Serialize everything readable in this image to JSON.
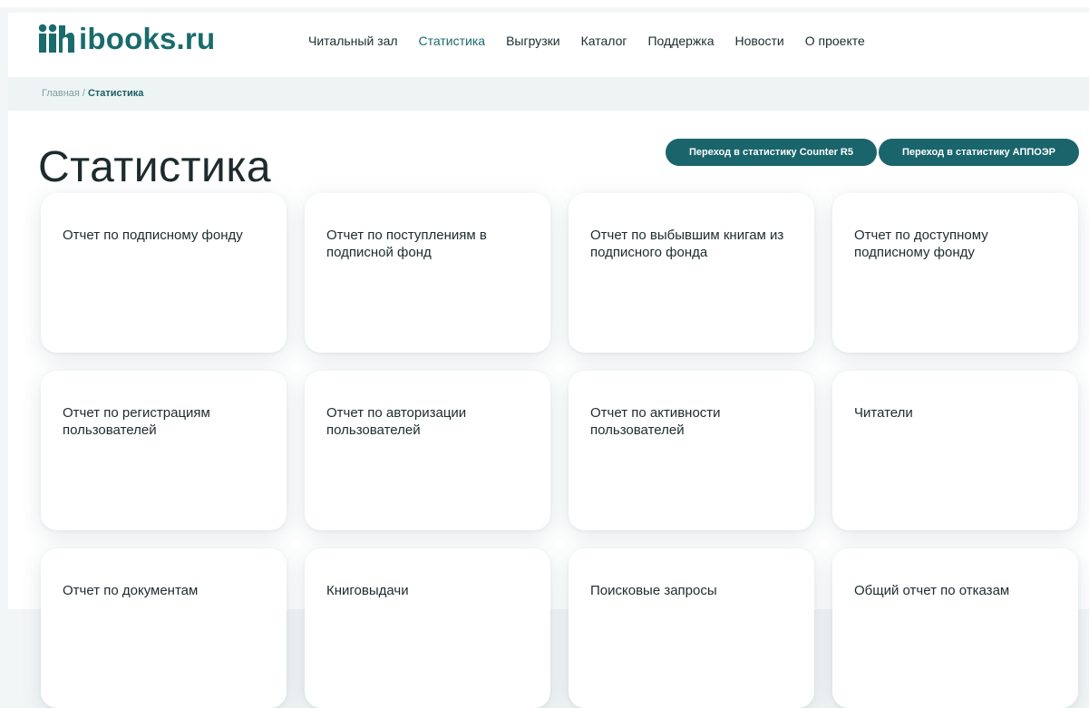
{
  "brand": {
    "logo_text": "ibooks.ru",
    "logo_icon": "ibooks-logo-icon",
    "color": "#1a6b6b"
  },
  "nav": {
    "items": [
      {
        "label": "Читальный зал"
      },
      {
        "label": "Статистика",
        "active": true
      },
      {
        "label": "Выгрузки"
      },
      {
        "label": "Каталог"
      },
      {
        "label": "Поддержка"
      },
      {
        "label": "Новости"
      },
      {
        "label": "О проекте"
      }
    ]
  },
  "breadcrumb": {
    "home": "Главная",
    "separator": "/",
    "current": "Статистика"
  },
  "page": {
    "title": "Статистика"
  },
  "actions": {
    "counter_r5": "Переход в статистику Counter R5",
    "apposp": "Переход в статистику АППОЭР",
    "button_color": "#1a646b"
  },
  "cards": [
    {
      "label": "Отчет по подписному фонду"
    },
    {
      "label": "Отчет по поступлениям в подписной фонд"
    },
    {
      "label": "Отчет по выбывшим книгам из подписного фонда"
    },
    {
      "label": "Отчет по доступному подписному фонду"
    },
    {
      "label": "Отчет по регистрациям пользователей"
    },
    {
      "label": "Отчет по авторизации пользователей"
    },
    {
      "label": "Отчет по активности пользователей"
    },
    {
      "label": "Читатели"
    },
    {
      "label": "Отчет по документам"
    },
    {
      "label": "Книговыдачи"
    },
    {
      "label": "Поисковые запросы"
    },
    {
      "label": "Общий отчет по отказам"
    }
  ]
}
